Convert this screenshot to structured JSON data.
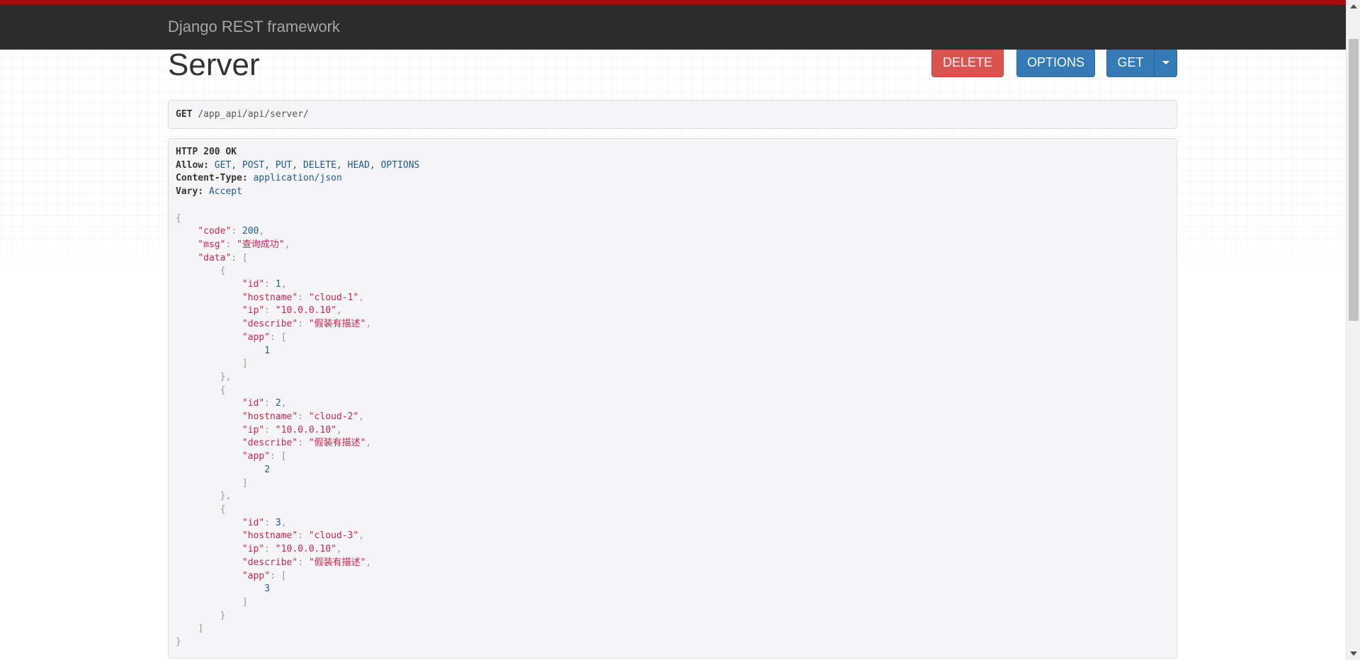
{
  "navbar": {
    "brand": "Django REST framework"
  },
  "header": {
    "title": "Server",
    "buttons": {
      "delete": "DELETE",
      "options": "OPTIONS",
      "get": "GET"
    }
  },
  "request": {
    "method": "GET",
    "path": "/app_api/api/server/"
  },
  "response": {
    "status": "HTTP 200 OK",
    "headers": [
      {
        "key": "Allow:",
        "value": "GET, POST, PUT, DELETE, HEAD, OPTIONS"
      },
      {
        "key": "Content-Type:",
        "value": "application/json"
      },
      {
        "key": "Vary:",
        "value": "Accept"
      }
    ],
    "body": {
      "code": 200,
      "msg": "查询成功",
      "data": [
        {
          "id": 1,
          "hostname": "cloud-1",
          "ip": "10.0.0.10",
          "describe": "假装有描述",
          "app": [
            1
          ]
        },
        {
          "id": 2,
          "hostname": "cloud-2",
          "ip": "10.0.0.10",
          "describe": "假装有描述",
          "app": [
            2
          ]
        },
        {
          "id": 3,
          "hostname": "cloud-3",
          "ip": "10.0.0.10",
          "describe": "假装有描述",
          "app": [
            3
          ]
        }
      ]
    }
  }
}
